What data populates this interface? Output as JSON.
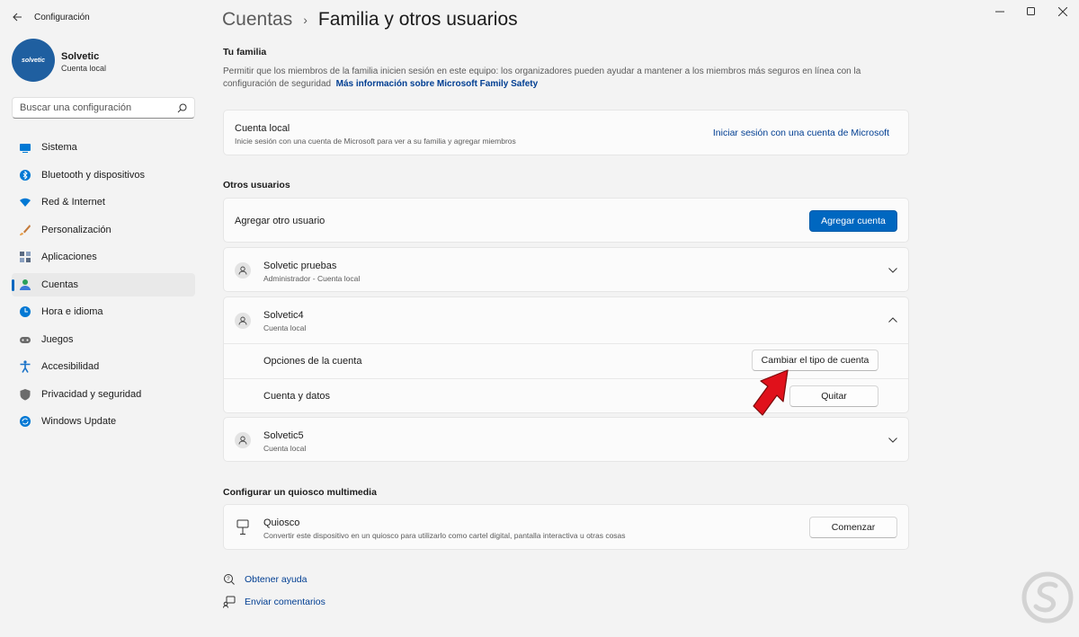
{
  "window": {
    "title": "Configuración"
  },
  "user": {
    "name": "Solvetic",
    "type": "Cuenta local",
    "avatar_text": "solvetic"
  },
  "search": {
    "placeholder": "Buscar una configuración"
  },
  "nav": [
    {
      "label": "Sistema",
      "icon": "monitor-icon",
      "color": "#0078d4"
    },
    {
      "label": "Bluetooth y dispositivos",
      "icon": "bluetooth-icon",
      "color": "#0078d4"
    },
    {
      "label": "Red & Internet",
      "icon": "wifi-icon",
      "color": "#0078d4"
    },
    {
      "label": "Personalización",
      "icon": "brush-icon",
      "color": "#c47a3a"
    },
    {
      "label": "Aplicaciones",
      "icon": "apps-icon",
      "color": "#5a6a82"
    },
    {
      "label": "Cuentas",
      "icon": "account-icon",
      "color": "#2aa05a",
      "active": true
    },
    {
      "label": "Hora e idioma",
      "icon": "globe-clock-icon",
      "color": "#0078d4"
    },
    {
      "label": "Juegos",
      "icon": "gamepad-icon",
      "color": "#6b6b6b"
    },
    {
      "label": "Accesibilidad",
      "icon": "accessibility-icon",
      "color": "#1a73c8"
    },
    {
      "label": "Privacidad y seguridad",
      "icon": "shield-icon",
      "color": "#6b6b6b"
    },
    {
      "label": "Windows Update",
      "icon": "update-icon",
      "color": "#0078d4"
    }
  ],
  "breadcrumb": {
    "parent": "Cuentas",
    "separator": "›",
    "current": "Familia y otros usuarios"
  },
  "family": {
    "title": "Tu familia",
    "description": "Permitir que los miembros de la familia inicien sesión en este equipo: los organizadores pueden ayudar a mantener a los miembros más seguros en línea con la configuración de seguridad",
    "link": "Más información sobre Microsoft Family Safety",
    "card_title": "Cuenta local",
    "card_sub": "Inicie sesión con una cuenta de Microsoft para ver a su familia y agregar miembros",
    "card_link": "Iniciar sesión con una cuenta de Microsoft"
  },
  "others": {
    "title": "Otros usuarios",
    "add_label": "Agregar otro usuario",
    "add_button": "Agregar cuenta",
    "users": [
      {
        "name": "Solvetic pruebas",
        "type": "Administrador - Cuenta local"
      },
      {
        "name": "Solvetic4",
        "type": "Cuenta local"
      },
      {
        "name": "Solvetic5",
        "type": "Cuenta local"
      }
    ],
    "options_label": "Opciones de la cuenta",
    "options_button": "Cambiar el tipo de cuenta",
    "data_label": "Cuenta y datos",
    "data_button": "Quitar"
  },
  "kiosk": {
    "title": "Configurar un quiosco multimedia",
    "name": "Quiosco",
    "sub": "Convertir este dispositivo en un quiosco para utilizarlo como cartel digital, pantalla interactiva u otras cosas",
    "button": "Comenzar"
  },
  "footer": {
    "help": "Obtener ayuda",
    "feedback": "Enviar comentarios"
  },
  "colors": {
    "accent": "#0067c0",
    "link": "#003e92",
    "arrow": "#e0111b"
  }
}
